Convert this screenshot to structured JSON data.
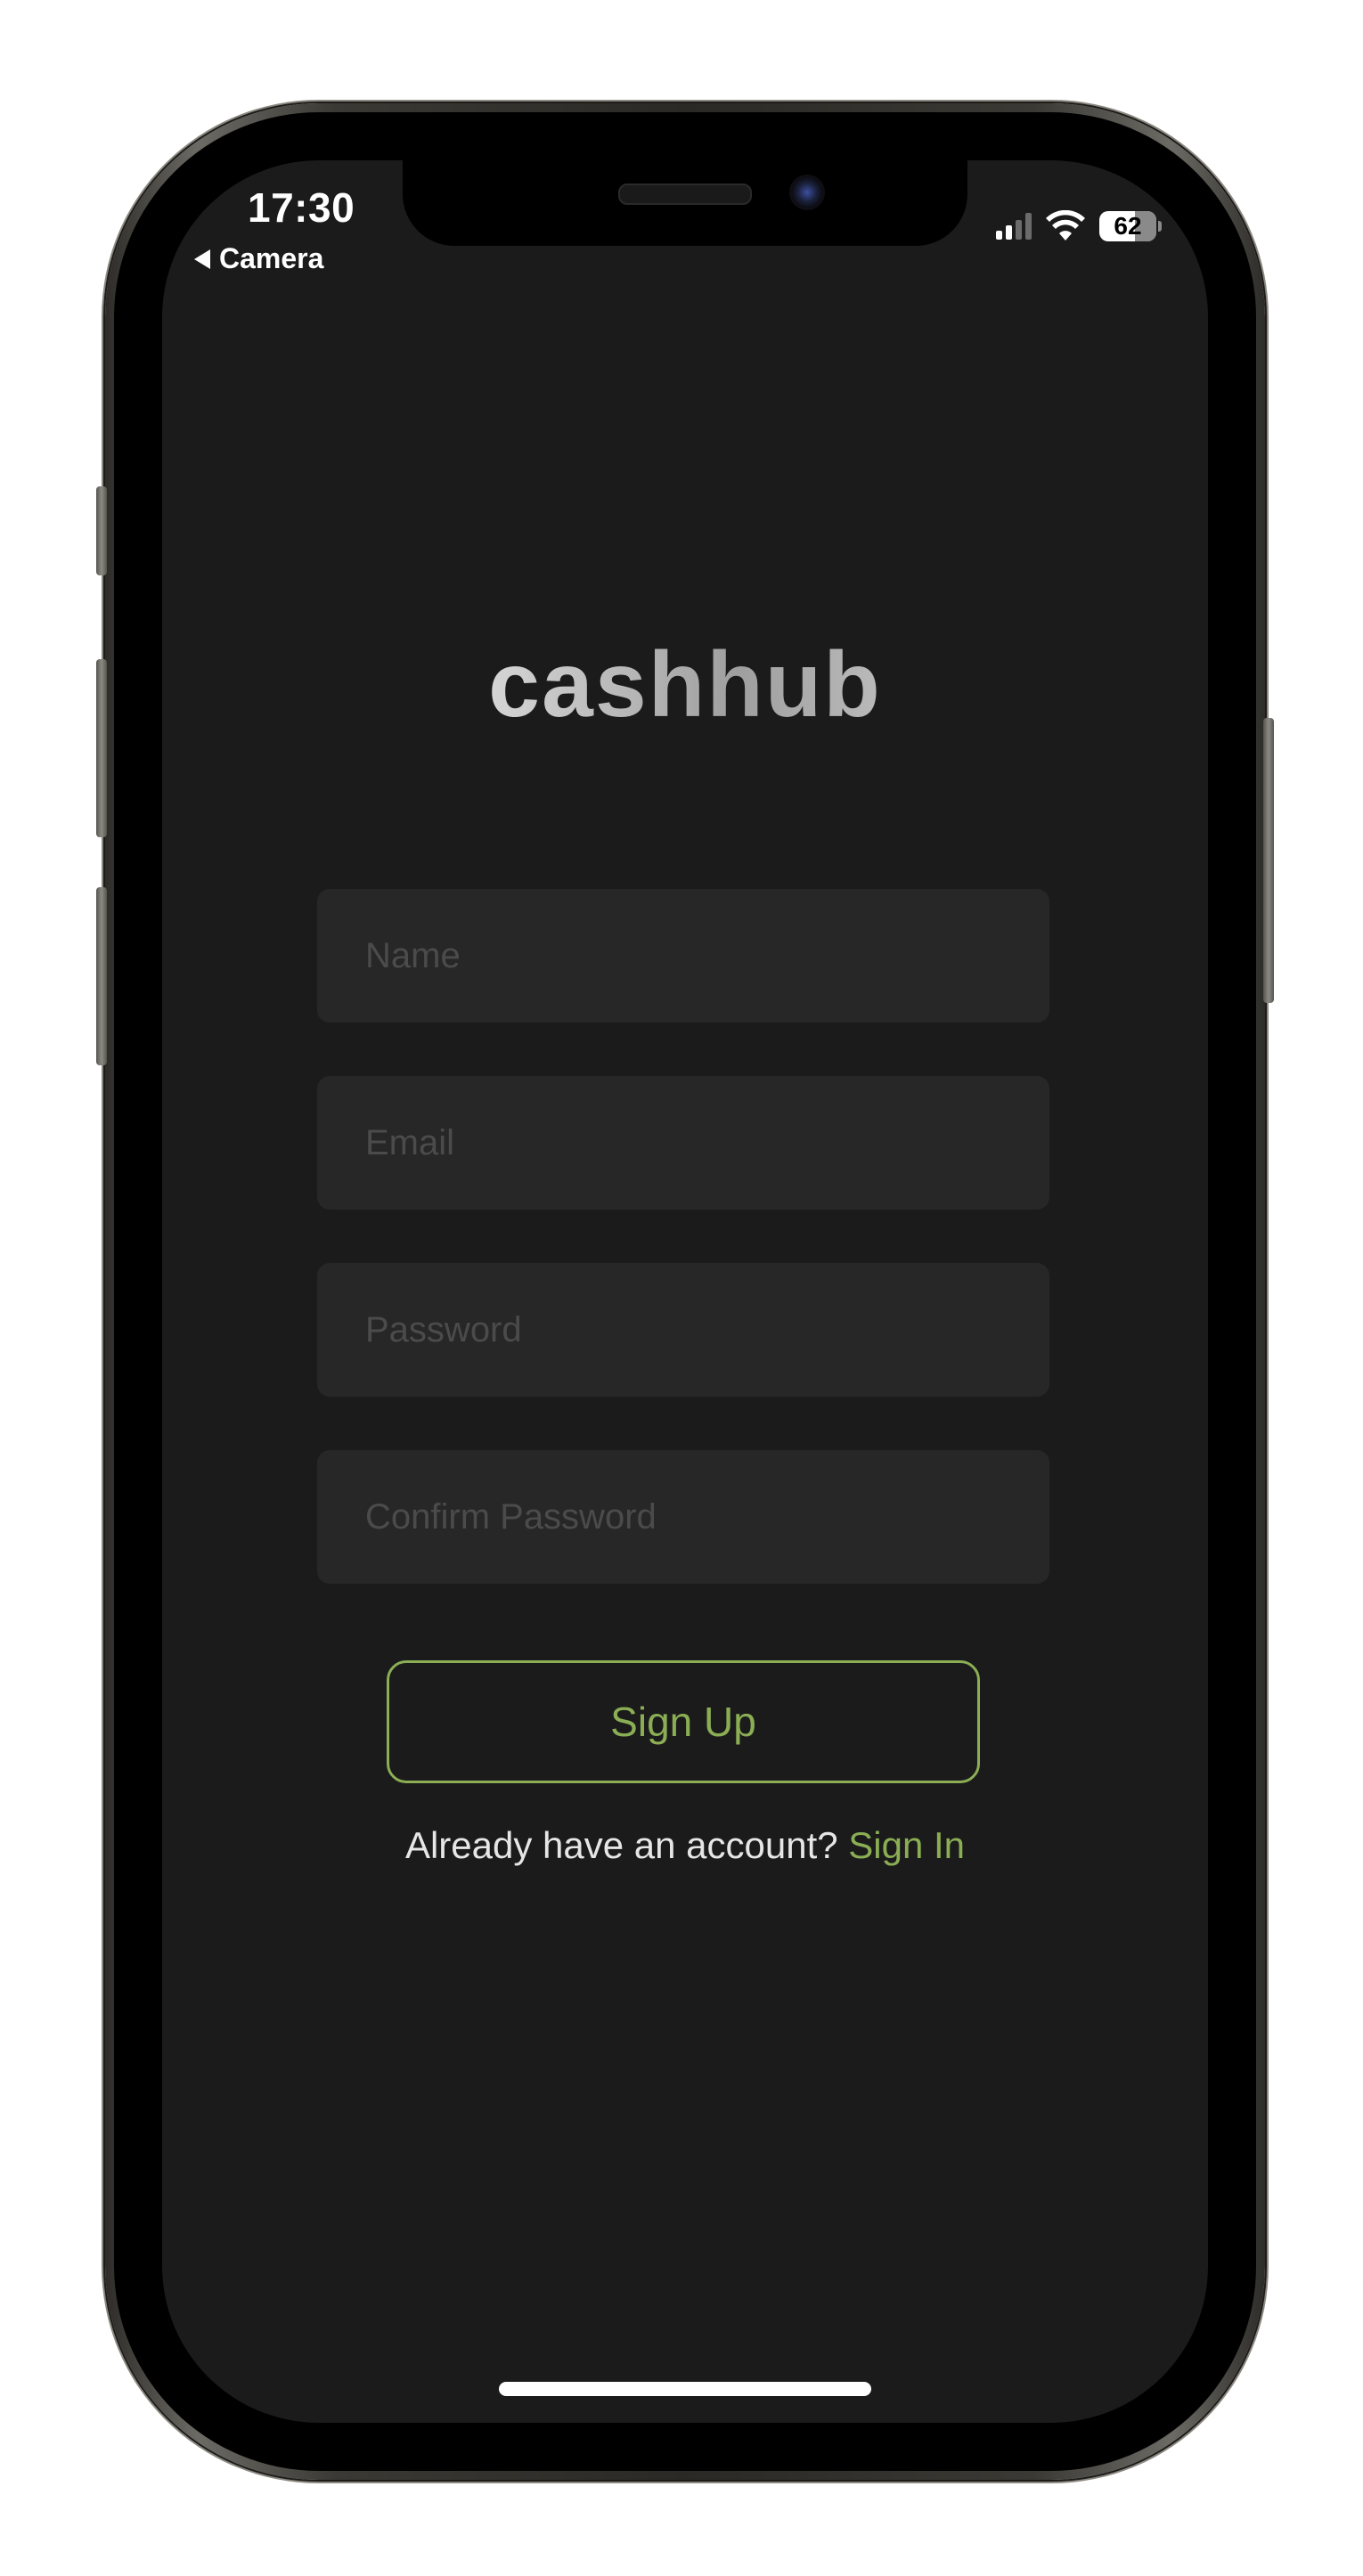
{
  "status_bar": {
    "time": "17:30",
    "back_label": "Camera",
    "battery_level": "62",
    "signal_bars_active": 2,
    "signal_bars_total": 4,
    "icons": [
      "back-arrow-icon",
      "signal-icon",
      "wifi-icon",
      "battery-icon"
    ]
  },
  "app": {
    "logo_text": "cashhub",
    "form": {
      "name_placeholder": "Name",
      "email_placeholder": "Email",
      "password_placeholder": "Password",
      "confirm_password_placeholder": "Confirm Password",
      "submit_label": "Sign Up"
    },
    "signin_prompt": "Already have an account?",
    "signin_link": "Sign In"
  },
  "colors": {
    "background": "#1b1b1b",
    "field_background": "#272727",
    "accent": "#8bae55",
    "placeholder": "#4b4b4b",
    "text": "#e6e6e6"
  }
}
